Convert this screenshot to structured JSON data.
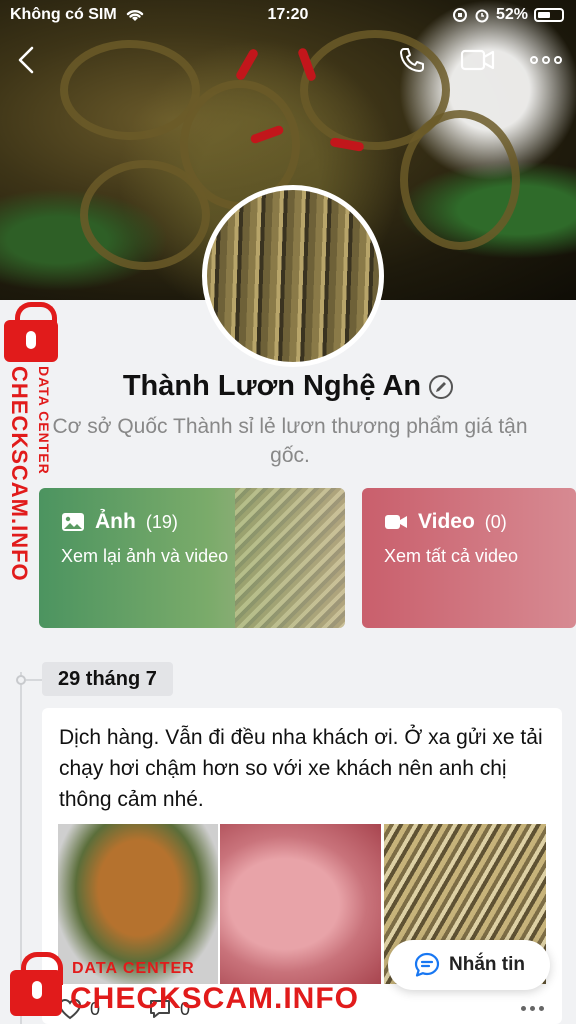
{
  "status_bar": {
    "carrier": "Không có SIM",
    "time": "17:20",
    "battery": "52%"
  },
  "profile": {
    "name": "Thành Lươn Nghệ An",
    "description": "Cơ sở Quốc Thành sỉ lẻ lươn thương phẩm giá tận gốc."
  },
  "media": {
    "photos": {
      "label": "Ảnh",
      "count": "(19)",
      "subtitle": "Xem lại ảnh và video"
    },
    "videos": {
      "label": "Video",
      "count": "(0)",
      "subtitle": "Xem tất cả video"
    }
  },
  "timeline": {
    "date": "29 tháng 7",
    "post": {
      "text": "Dịch hàng. Vẫn đi đều nha khách ơi. Ở xa gửi xe tải chạy hơi chậm hơn so với xe khách nên anh chị thông cảm nhé.",
      "likes": "0",
      "comments": "0"
    }
  },
  "message_button": {
    "label": "Nhắn tin"
  },
  "watermark": {
    "side_small": "DATA CENTER",
    "side_large": "CHECKSCAM.INFO",
    "bottom_small": "DATA CENTER",
    "bottom_large": "CHECKSCAM.INFO"
  },
  "colors": {
    "photo_card": "#4c9460",
    "video_card": "#c95f6c",
    "watermark_red": "#e11b1b"
  }
}
